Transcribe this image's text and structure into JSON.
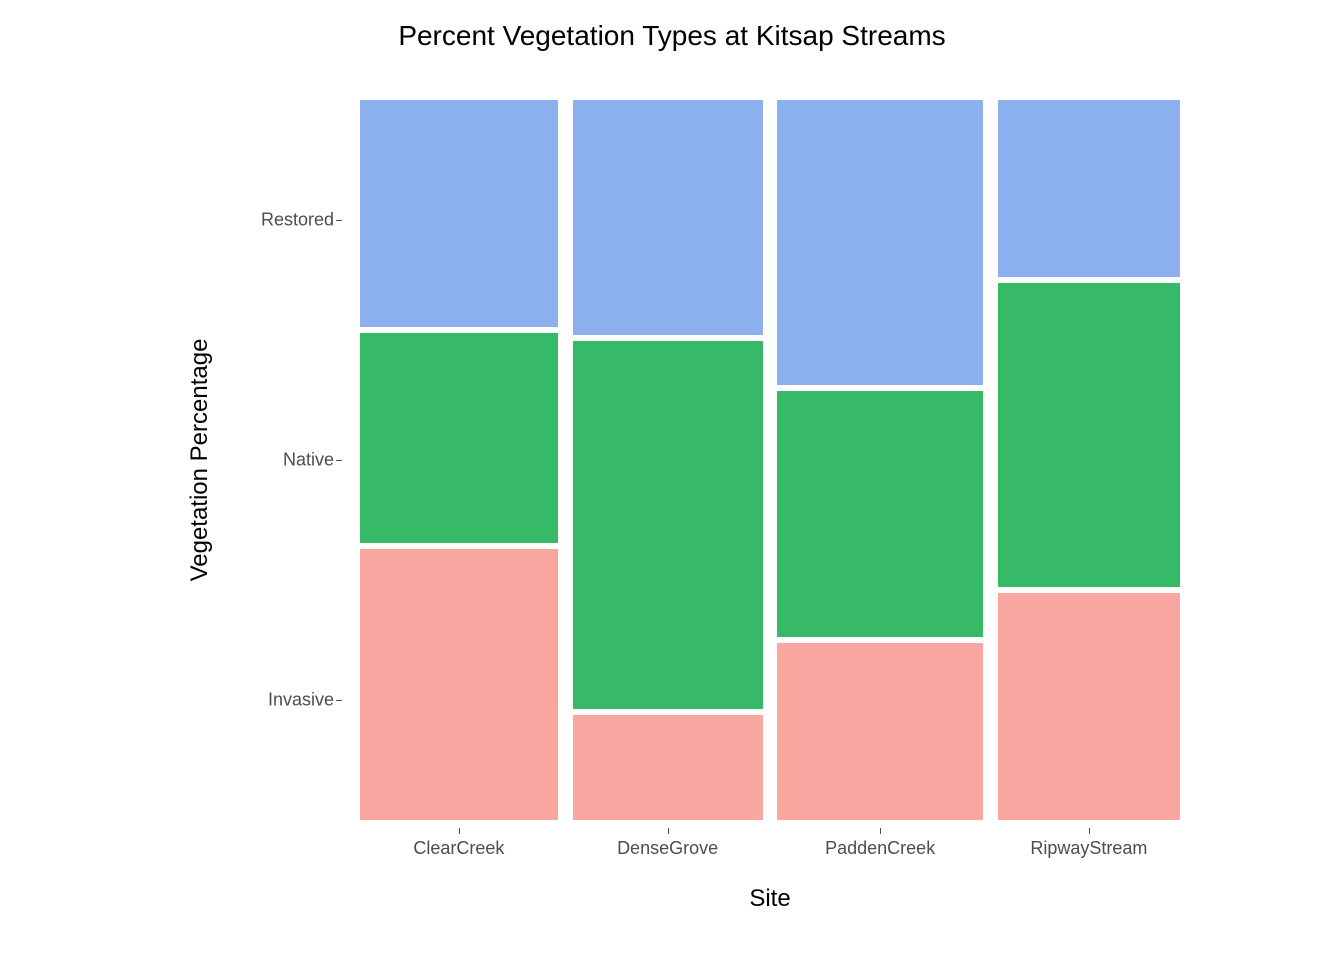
{
  "chart_data": {
    "type": "bar",
    "title": "Percent Vegetation Types at Kitsap Streams",
    "xlabel": "Site",
    "ylabel": "Vegetation Percentage",
    "categories": [
      "ClearCreek",
      "DenseGrove",
      "PaddenCreek",
      "RipwayStream"
    ],
    "y_categories": [
      "Invasive",
      "Native",
      "Restored"
    ],
    "series": [
      {
        "name": "Invasive",
        "color": "#f8a7a0",
        "values": [
          38,
          15,
          25,
          32
        ]
      },
      {
        "name": "Native",
        "color": "#37ba68",
        "values": [
          30,
          52,
          35,
          43
        ]
      },
      {
        "name": "Restored",
        "color": "#8bb0ed",
        "values": [
          32,
          33,
          40,
          25
        ]
      }
    ],
    "bar_widths": [
      0.255,
      0.245,
      0.265,
      0.235
    ],
    "ylim": [
      0,
      100
    ]
  }
}
